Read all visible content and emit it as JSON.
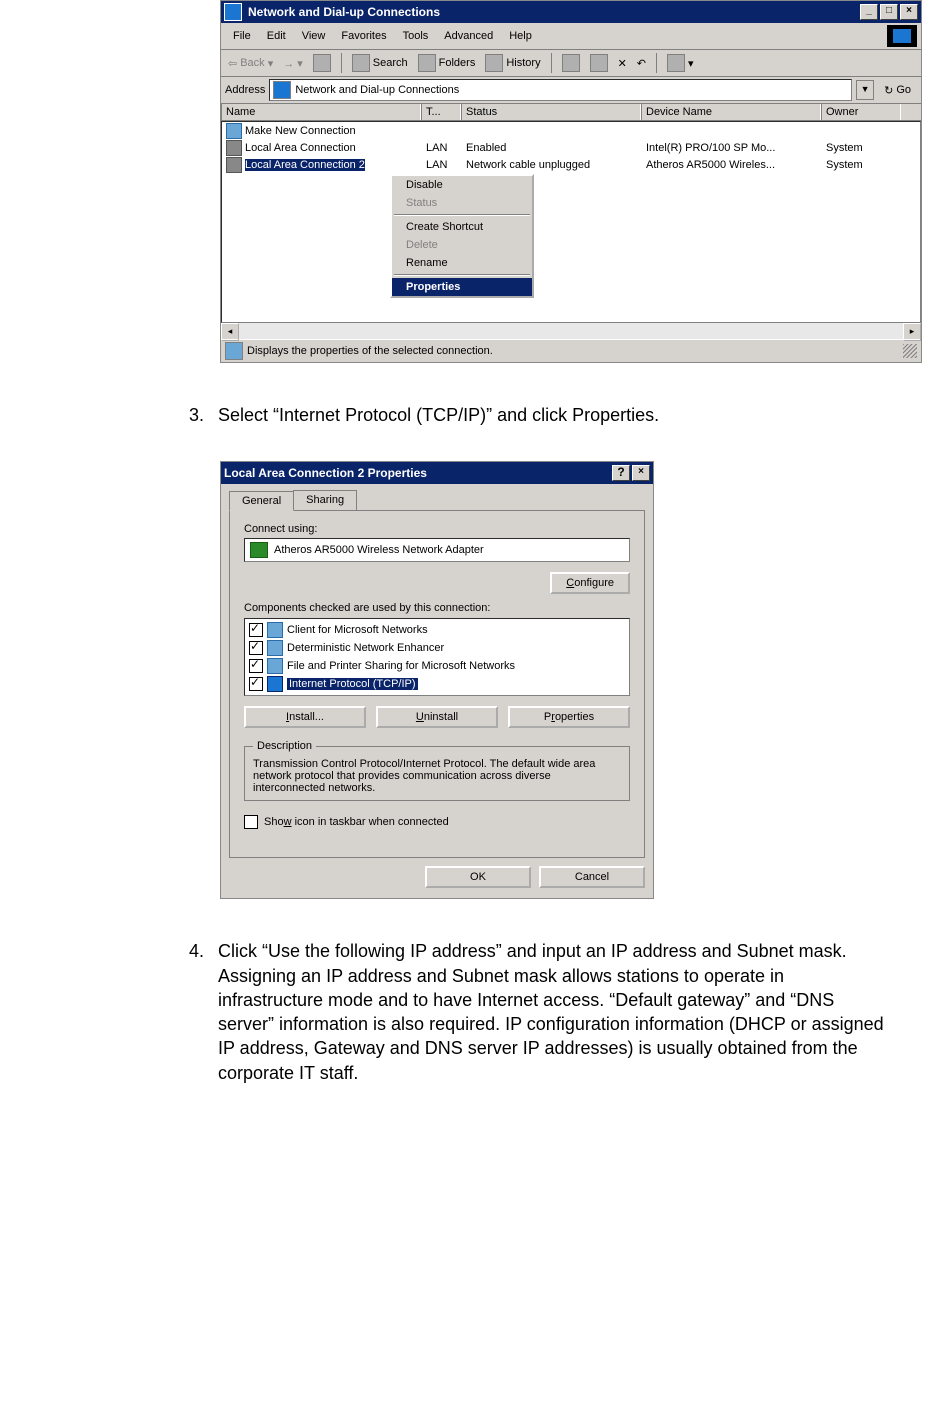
{
  "win1": {
    "title": "Network and Dial-up Connections",
    "menu": [
      "File",
      "Edit",
      "View",
      "Favorites",
      "Tools",
      "Advanced",
      "Help"
    ],
    "toolbar": {
      "back": "Back",
      "search": "Search",
      "folders": "Folders",
      "history": "History"
    },
    "addressLabel": "Address",
    "addressValue": "Network and Dial-up Connections",
    "go": "Go",
    "columns": {
      "name": "Name",
      "type": "T...",
      "status": "Status",
      "device": "Device Name",
      "owner": "Owner"
    },
    "rows": [
      {
        "name": "Make New Connection",
        "type": "",
        "status": "",
        "device": "",
        "owner": ""
      },
      {
        "name": "Local Area Connection",
        "type": "LAN",
        "status": "Enabled",
        "device": "Intel(R) PRO/100 SP Mo...",
        "owner": "System"
      },
      {
        "name": "Local Area Connection 2",
        "type": "LAN",
        "status": "Network cable unplugged",
        "device": "Atheros AR5000 Wireles...",
        "owner": "System"
      }
    ],
    "context": {
      "disable": "Disable",
      "status": "Status",
      "shortcut": "Create Shortcut",
      "delete": "Delete",
      "rename": "Rename",
      "properties": "Properties"
    },
    "statusbar": "Displays the properties of the selected connection."
  },
  "step3": {
    "num": "3.",
    "text": "Select “Internet Protocol (TCP/IP)” and click Properties."
  },
  "win2": {
    "title": "Local Area Connection 2 Properties",
    "tabs": {
      "general": "General",
      "sharing": "Sharing"
    },
    "connectUsing": "Connect using:",
    "adapter": "Atheros AR5000 Wireless Network Adapter",
    "configure": "Configure",
    "compLabel": "Components checked are used by this connection:",
    "components": [
      {
        "label": "Client for Microsoft Networks"
      },
      {
        "label": "Deterministic Network Enhancer"
      },
      {
        "label": "File and Printer Sharing for Microsoft Networks"
      },
      {
        "label": "Internet Protocol (TCP/IP)"
      }
    ],
    "install": "Install...",
    "uninstall": "Uninstall",
    "properties": "Properties",
    "descLegend": "Description",
    "descText": "Transmission Control Protocol/Internet Protocol. The default wide area network protocol that provides communication across diverse interconnected networks.",
    "showIcon": "Show icon in taskbar when connected",
    "ok": "OK",
    "cancel": "Cancel"
  },
  "step4": {
    "num": "4.",
    "text": "Click “Use the following IP address” and input an IP address and Subnet mask. Assigning an IP address and Subnet mask allows stations to operate in infrastructure mode and to have Internet access. “Default gateway” and “DNS server” information is also required. IP configuration information (DHCP or assigned IP address, Gateway and DNS server IP addresses) is usually obtained from the corporate IT staff."
  }
}
